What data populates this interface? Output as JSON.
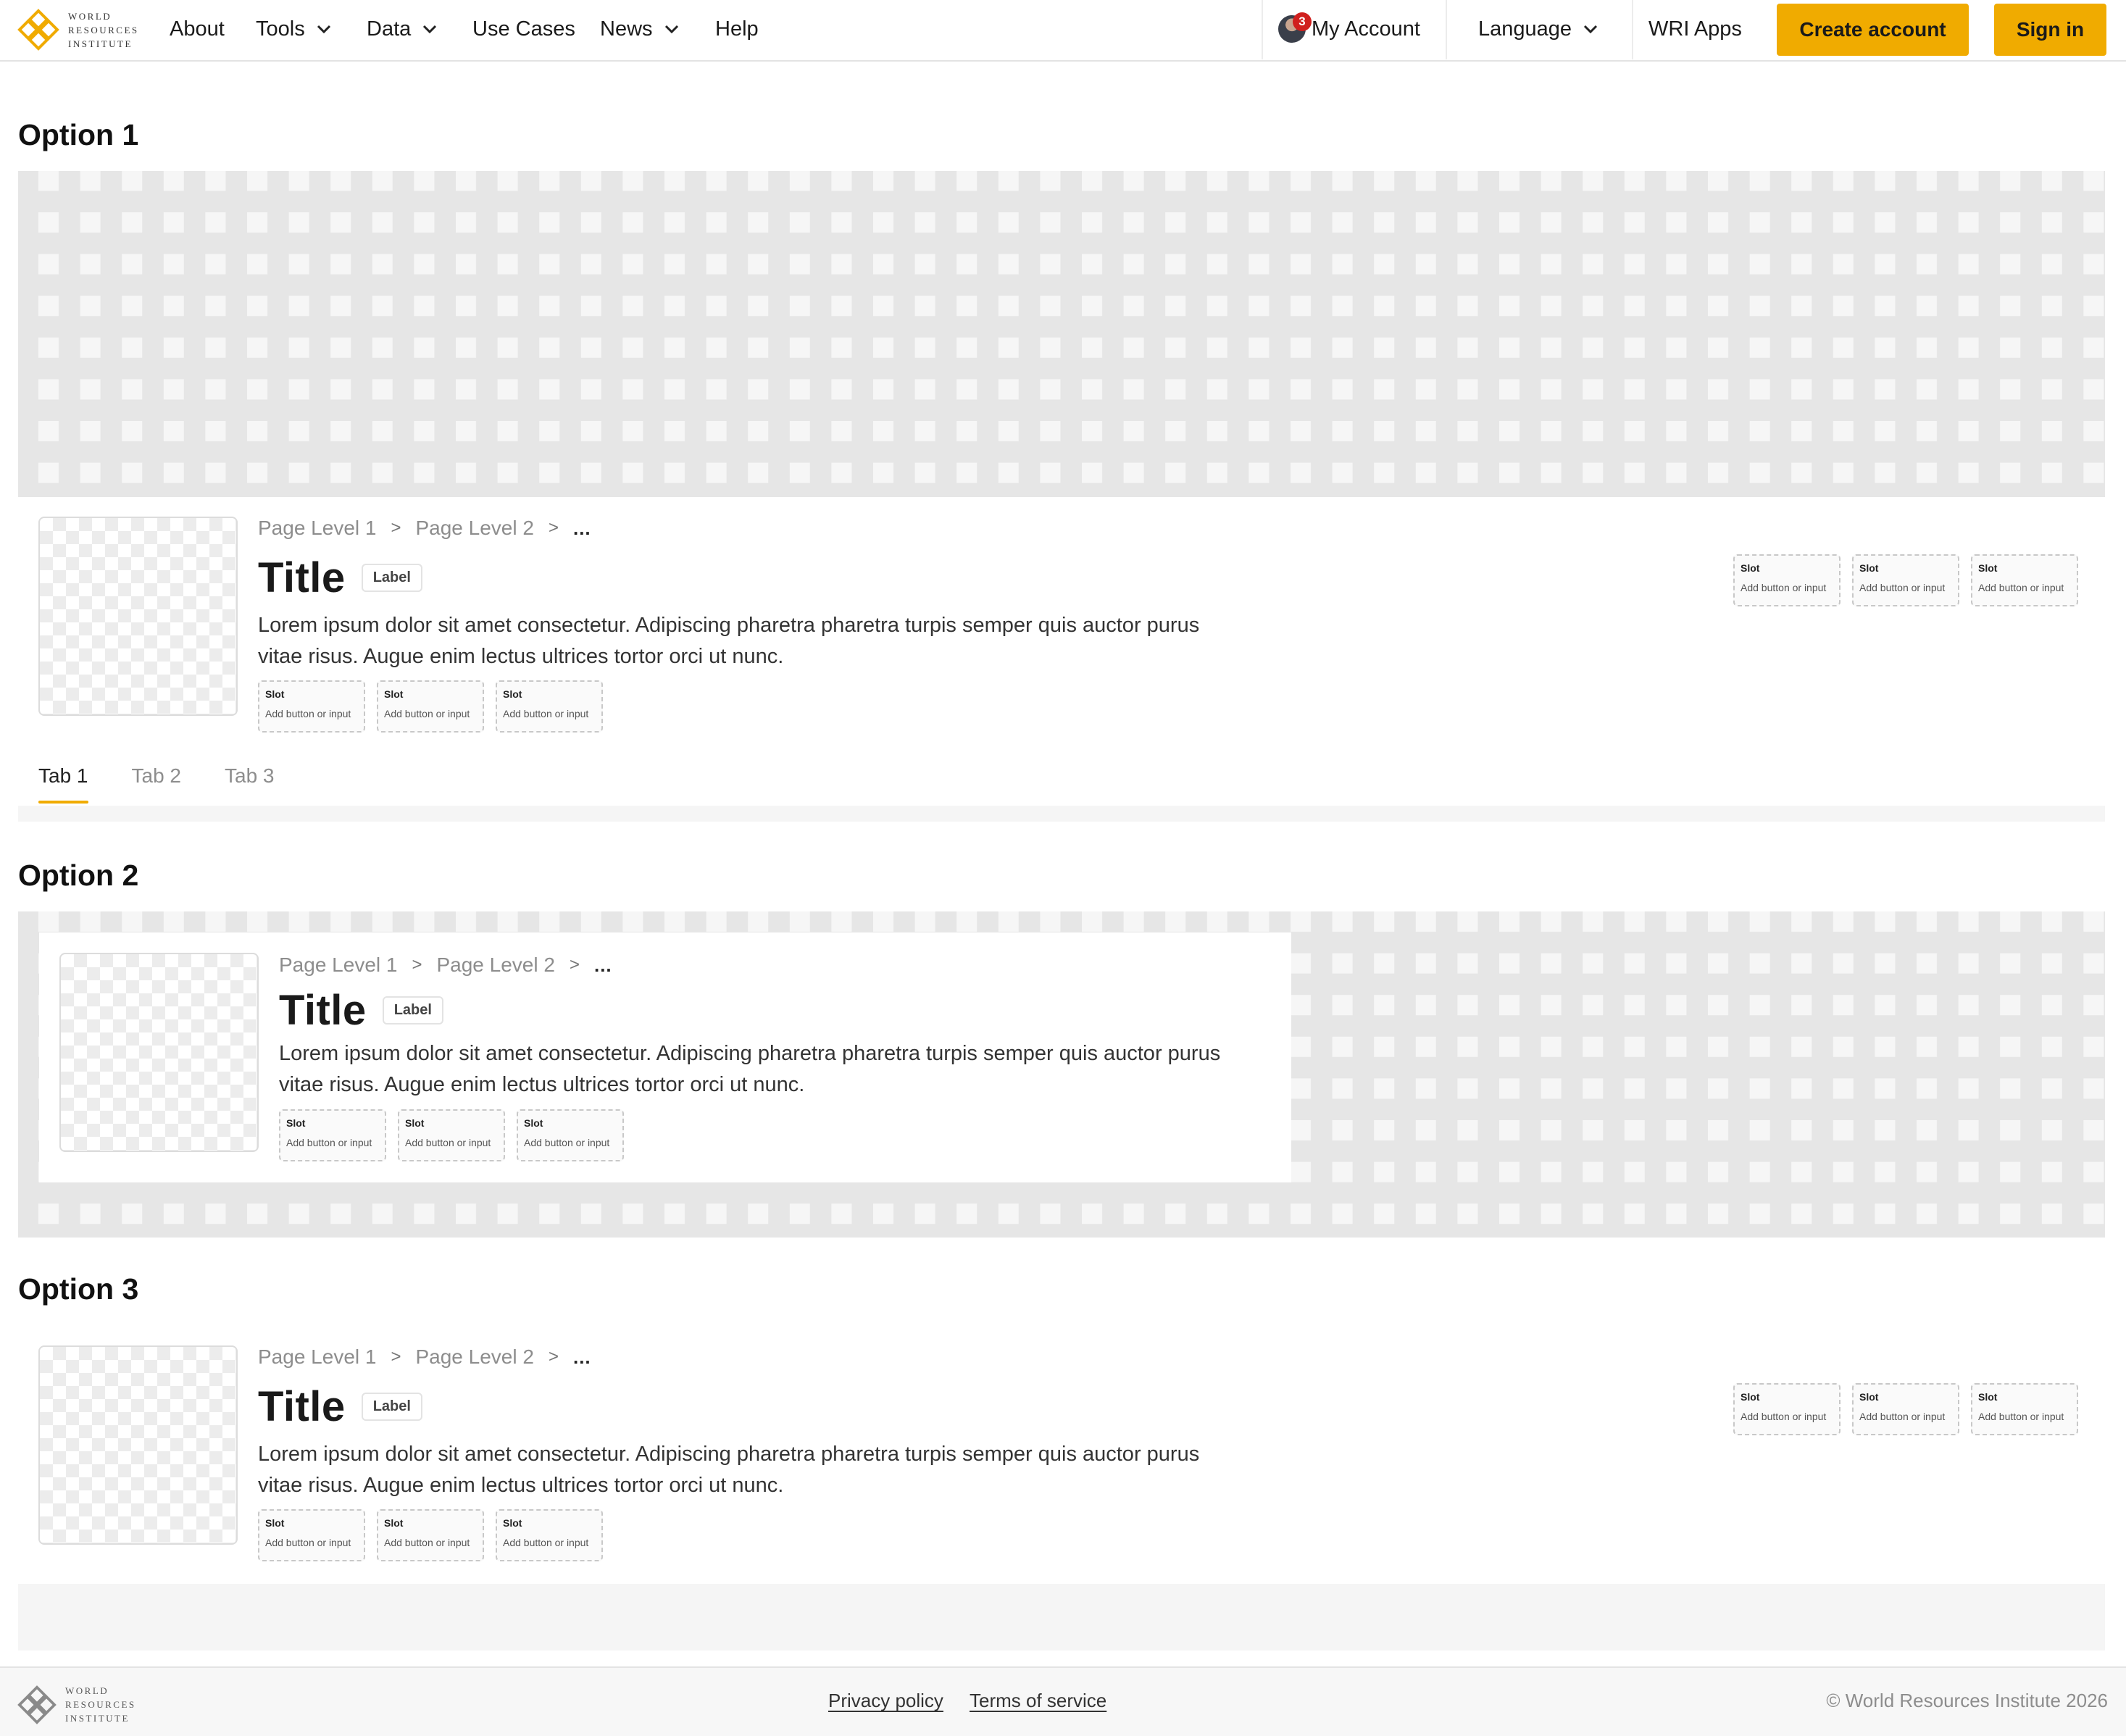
{
  "brand": {
    "logo_line1": "World",
    "logo_line2": "Resources",
    "logo_line3": "Institute",
    "accent_color": "#f0ab00"
  },
  "nav": {
    "about": "About",
    "tools": "Tools",
    "data": "Data",
    "use_cases": "Use Cases",
    "news": "News",
    "help": "Help",
    "notification_count": "3",
    "my_account": "My Account",
    "language": "Language",
    "wri_apps": "WRI Apps",
    "create_account": "Create account",
    "sign_in": "Sign in"
  },
  "header_block": {
    "crumb1": "Page Level 1",
    "crumb2": "Page Level 2",
    "sep": ">",
    "more": "...",
    "title": "Title",
    "label": "Label",
    "description_line1": "Lorem ipsum dolor sit amet consectetur. Adipiscing pharetra pharetra turpis semper quis auctor purus",
    "description_line2": "vitae risus. Augue enim lectus ultrices tortor orci ut nunc.",
    "slot_title": "Slot",
    "slot_sub": "Add button or input"
  },
  "options": {
    "option1": "Option 1",
    "option2": "Option 2",
    "option3": "Option 3"
  },
  "tabs": {
    "tab1": "Tab 1",
    "tab2": "Tab 2",
    "tab3": "Tab 3"
  },
  "footer": {
    "privacy": "Privacy policy",
    "terms": "Terms of service",
    "copyright": "© World Resources Institute 2026"
  }
}
